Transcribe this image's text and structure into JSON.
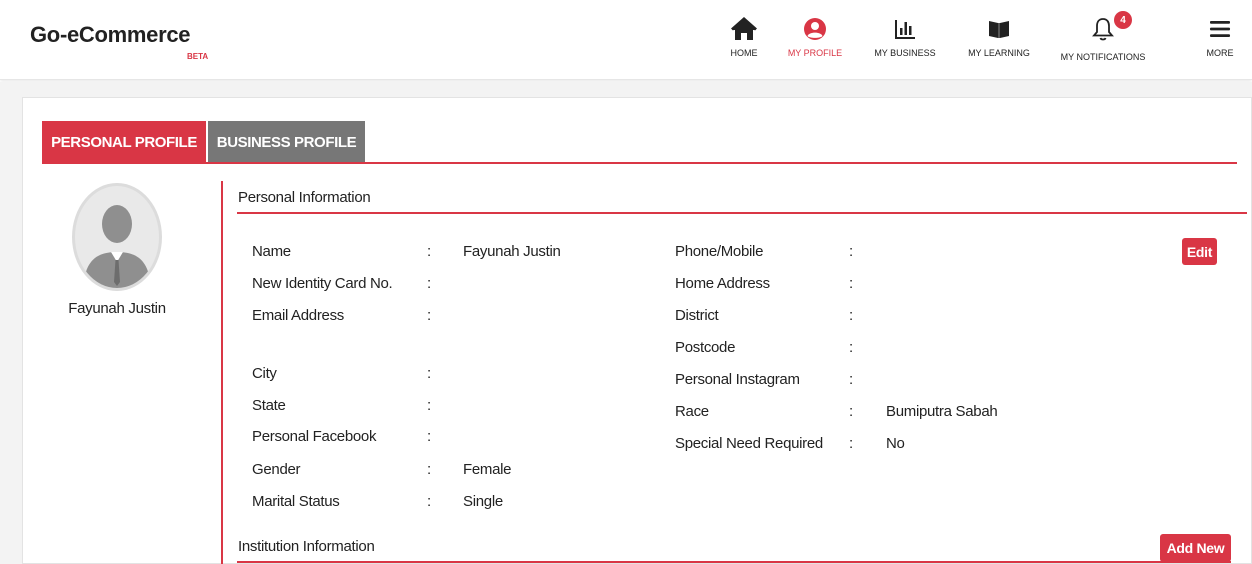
{
  "brand": {
    "name": "Go-eCommerce",
    "tag": "BETA"
  },
  "nav": [
    {
      "label": "HOME",
      "icon": "home-icon"
    },
    {
      "label": "MY PROFILE",
      "icon": "user-icon",
      "active": true
    },
    {
      "label": "MY BUSINESS",
      "icon": "bar-chart-icon"
    },
    {
      "label": "MY LEARNING",
      "icon": "book-icon"
    },
    {
      "label": "MY NOTIFICATIONS",
      "icon": "bell-icon",
      "badge": "4"
    },
    {
      "label": "MORE",
      "icon": "menu-icon"
    }
  ],
  "tabs": {
    "personal": "PERSONAL PROFILE",
    "business": "BUSINESS PROFILE"
  },
  "profile": {
    "name": "Fayunah Justin"
  },
  "personal_info": {
    "title": "Personal Information",
    "edit_label": "Edit",
    "left": [
      {
        "label": "Name",
        "value": "Fayunah Justin"
      },
      {
        "label": "New Identity Card No.",
        "value": ""
      },
      {
        "label": "Email Address",
        "value": ""
      },
      {
        "label": "City",
        "value": ""
      },
      {
        "label": "State",
        "value": ""
      },
      {
        "label": "Personal Facebook",
        "value": ""
      },
      {
        "label": "Gender",
        "value": "Female"
      },
      {
        "label": "Marital Status",
        "value": "Single"
      }
    ],
    "right": [
      {
        "label": "Phone/Mobile",
        "value": ""
      },
      {
        "label": "Home Address",
        "value": ""
      },
      {
        "label": "District",
        "value": ""
      },
      {
        "label": "Postcode",
        "value": ""
      },
      {
        "label": "Personal Instagram",
        "value": ""
      },
      {
        "label": "Race",
        "value": "Bumiputra Sabah"
      },
      {
        "label": "Special Need Required",
        "value": "No"
      }
    ]
  },
  "institution_info": {
    "title": "Institution Information",
    "add_label": "Add New"
  },
  "colors": {
    "accent": "#d93645",
    "tab_inactive": "#777777",
    "background": "#f3f3f3"
  }
}
